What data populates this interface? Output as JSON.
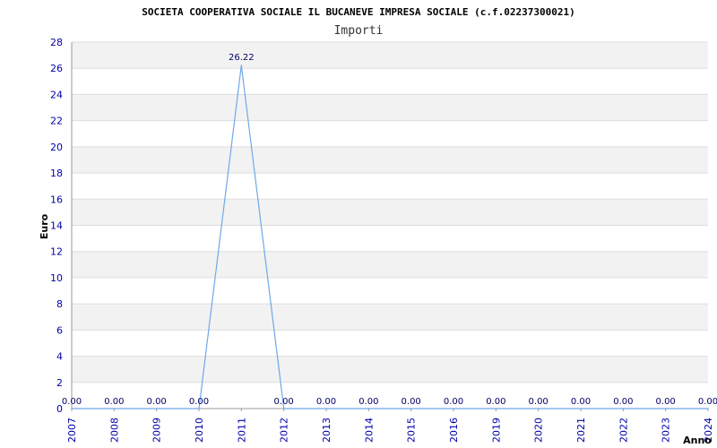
{
  "chart_data": {
    "type": "line",
    "title": "SOCIETA COOPERATIVA SOCIALE IL BUCANEVE IMPRESA SOCIALE (c.f.02237300021)",
    "subtitle": "Importi",
    "xlabel": "Anno",
    "ylabel": "Euro",
    "ylim": [
      0,
      28
    ],
    "y_ticks": [
      "0",
      "2",
      "4",
      "6",
      "8",
      "10",
      "12",
      "14",
      "16",
      "18",
      "20",
      "22",
      "24",
      "26",
      "28"
    ],
    "grid": true,
    "x": [
      "2007",
      "2008",
      "2009",
      "2010",
      "2011",
      "2012",
      "2013",
      "2014",
      "2015",
      "2016",
      "2019",
      "2020",
      "2021",
      "2022",
      "2023",
      "2024"
    ],
    "series": [
      {
        "values": [
          0,
          0,
          0,
          0,
          26.22,
          0,
          0,
          0,
          0,
          0,
          0,
          0,
          0,
          0,
          0,
          0
        ],
        "labels": [
          "0.00",
          "0.00",
          "0.00",
          "0.00",
          "26.22",
          "0.00",
          "0.00",
          "0.00",
          "0.00",
          "0.00",
          "0.00",
          "0.00",
          "0.00",
          "0.00",
          "0.00",
          "0.00"
        ]
      }
    ],
    "colors": {
      "line": "#6fa8e8",
      "band": "#f2f2f2",
      "grid": "#dddddd",
      "ticks": "#0000aa"
    }
  }
}
